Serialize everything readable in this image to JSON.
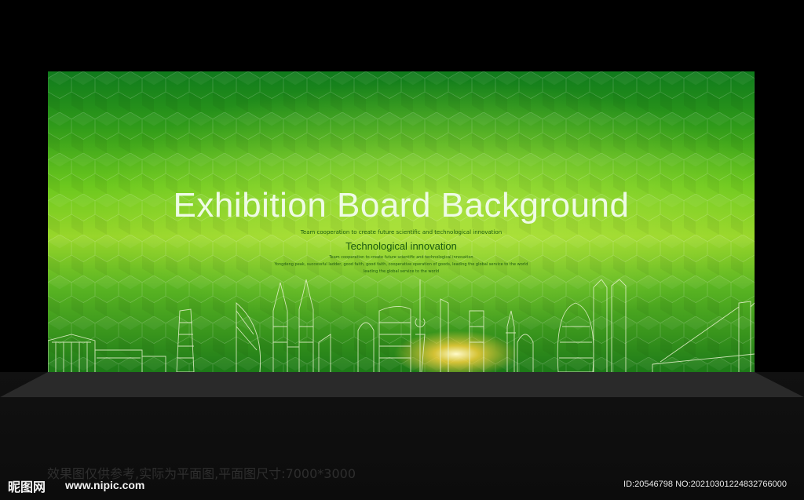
{
  "board": {
    "title": "Exhibition Board Background",
    "subtitle_small": "Team cooperation to create future scientific and technological innovation",
    "subtitle_main": "Technological innovation",
    "line_1": "Team cooperation to create future scientific and technological innovation",
    "line_2": "Yongdeng peak, successful ladder, good faith, good faith, cooperative operation of goods, leading the global service to the world",
    "line_3": "leading the global service to the world"
  },
  "watermark": {
    "notice": "效果图仅供参考,实际为平面图,平面图尺寸:7000*3000",
    "logo": "昵图网",
    "url": "www.nipic.com",
    "id_text": "ID:20546798 NO:20210301224832766000"
  },
  "colors": {
    "background": "#000000",
    "board_green": "#6cc81e",
    "title_text": "#eefbe4",
    "subtitle_text": "#1a5a10"
  }
}
